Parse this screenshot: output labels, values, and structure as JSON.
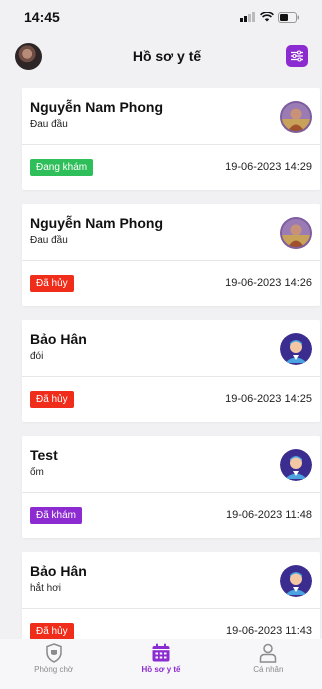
{
  "status_bar": {
    "time": "14:45"
  },
  "header": {
    "title": "Hồ sơ y tế"
  },
  "records": [
    {
      "name": "Nguyễn Nam Phong",
      "symptom": "Đau đầu",
      "status": "Đang khám",
      "status_color": "#2fbf5a",
      "datetime": "19-06-2023 14:29",
      "avatar": "photo"
    },
    {
      "name": "Nguyễn Nam Phong",
      "symptom": "Đau đầu",
      "status": "Đã hủy",
      "status_color": "#f02d1a",
      "datetime": "19-06-2023 14:26",
      "avatar": "photo"
    },
    {
      "name": "Bảo Hân",
      "symptom": "đói",
      "status": "Đã hủy",
      "status_color": "#f02d1a",
      "datetime": "19-06-2023 14:25",
      "avatar": "doctor"
    },
    {
      "name": "Test",
      "symptom": "ốm",
      "status": "Đã khám",
      "status_color": "#8b2bd0",
      "datetime": "19-06-2023 11:48",
      "avatar": "doctor"
    },
    {
      "name": "Bảo Hân",
      "symptom": "hắt hơi",
      "status": "Đã hủy",
      "status_color": "#f02d1a",
      "datetime": "19-06-2023 11:43",
      "avatar": "doctor"
    }
  ],
  "tabs": [
    {
      "label": "Phòng chờ",
      "icon": "shield-icon",
      "active": false
    },
    {
      "label": "Hồ sơ y tế",
      "icon": "calendar-icon",
      "active": true
    },
    {
      "label": "Cá nhân",
      "icon": "person-icon",
      "active": false
    }
  ],
  "colors": {
    "accent": "#8b2bd0",
    "success": "#2fbf5a",
    "danger": "#f02d1a"
  }
}
